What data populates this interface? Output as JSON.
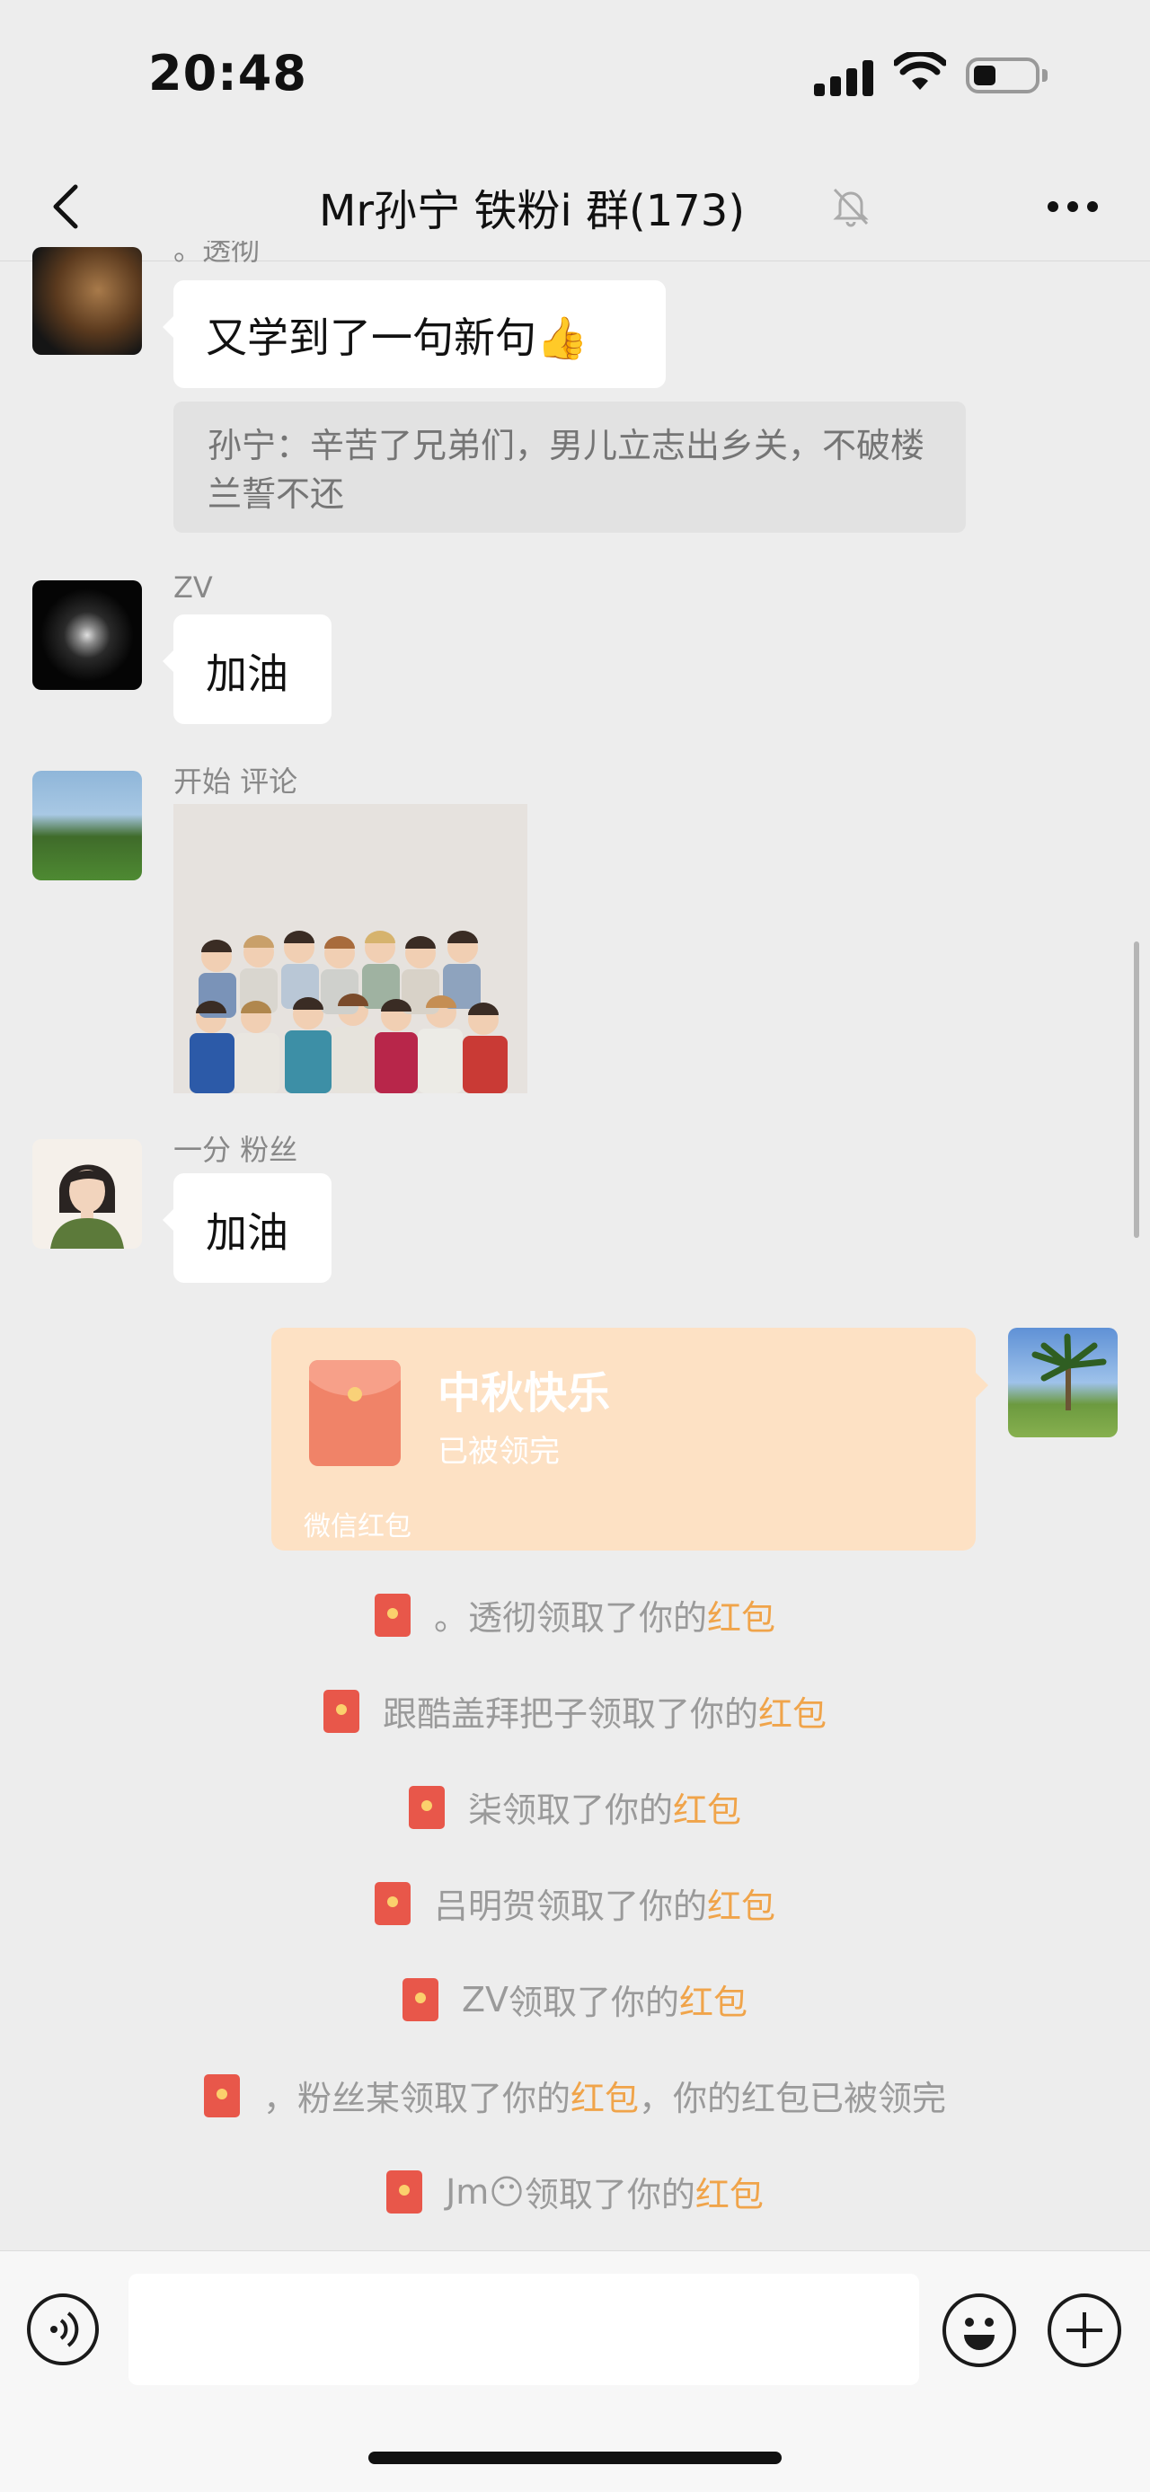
{
  "status_bar": {
    "time": "20:48"
  },
  "header": {
    "title": "Mr孙宁 铁粉i   群(173)"
  },
  "messages": [
    {
      "sender": "。透彻",
      "text": "又学到了一句新句",
      "emoji": "👍"
    },
    {
      "quote": "孙宁：辛苦了兄弟们，男儿立志出乡关，不破楼兰誓不还"
    },
    {
      "sender": "ZV",
      "text": "加油"
    },
    {
      "sender": "开始 评论"
    },
    {
      "sender": "一分 粉丝",
      "text": "加油"
    }
  ],
  "red_packet": {
    "title": "中秋快乐",
    "status": "已被领完",
    "footer": "微信红包"
  },
  "notices": [
    {
      "name": "。透彻",
      "action": "领取了你的",
      "highlight": "红包",
      "suffix": ""
    },
    {
      "name": "跟酷盖拜把子",
      "action": "领取了你的",
      "highlight": "红包",
      "suffix": ""
    },
    {
      "name": "柒",
      "action": "领取了你的",
      "highlight": "红包",
      "suffix": ""
    },
    {
      "name": "吕明贺",
      "action": "领取了你的",
      "highlight": "红包",
      "suffix": ""
    },
    {
      "name": "ZV ",
      "action": "领取了你的",
      "highlight": "红包",
      "suffix": ""
    },
    {
      "name": "，粉丝某",
      "action": "领取了你的",
      "highlight": "红包",
      "suffix": "，你的红包已被领完"
    },
    {
      "name": "Jm😶",
      "action": "领取了你的",
      "highlight": "红包",
      "suffix": ""
    }
  ],
  "colors": {
    "background": "#ededed",
    "red_packet": "#fde1c4",
    "highlight": "#f0a44a",
    "envelope": "#e8574a"
  },
  "icons": [
    "back-icon",
    "mute-icon",
    "more-icon",
    "voice-icon",
    "emoji-icon",
    "plus-icon",
    "red-packet-icon"
  ]
}
